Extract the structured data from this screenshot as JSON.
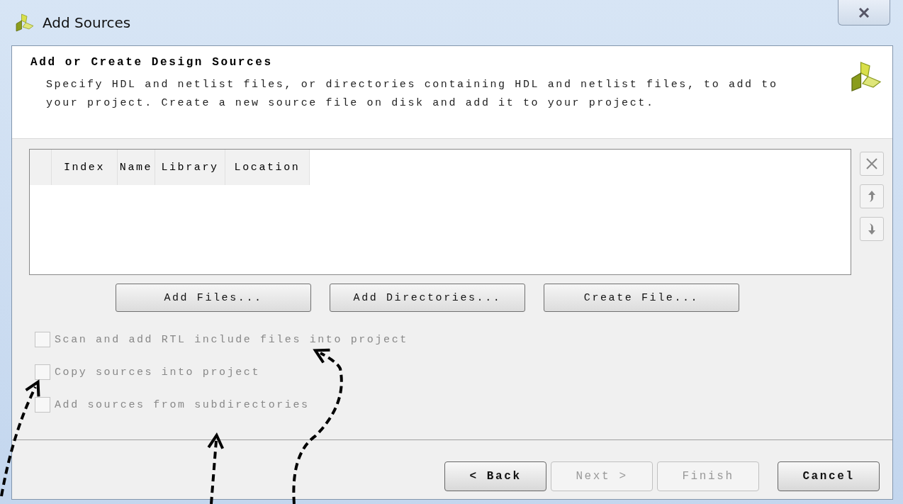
{
  "window": {
    "title": "Add Sources"
  },
  "header": {
    "title": "Add or Create Design Sources",
    "description": "Specify HDL and netlist files, or directories containing HDL and netlist files, to add to your project. Create a new source file on disk and add it to your project."
  },
  "table": {
    "columns": [
      "Index",
      "Name",
      "Library",
      "Location"
    ]
  },
  "side_buttons": [
    {
      "kind": "remove",
      "disabled": true
    },
    {
      "kind": "up",
      "disabled": true
    },
    {
      "kind": "down",
      "disabled": true
    }
  ],
  "add_buttons": [
    "Add Files...",
    "Add Directories...",
    "Create File..."
  ],
  "options": [
    {
      "label": "Scan and add RTL include files into project",
      "checked": false,
      "disabled": true
    },
    {
      "label": "Copy sources into project",
      "checked": false,
      "disabled": true
    },
    {
      "label": "Add sources from subdirectories",
      "checked": false,
      "disabled": true
    }
  ],
  "footer_buttons": [
    {
      "label": "< Back",
      "disabled": false
    },
    {
      "label": "Next >",
      "disabled": true
    },
    {
      "label": "Finish",
      "disabled": true
    },
    {
      "label": "Cancel",
      "disabled": false
    }
  ]
}
